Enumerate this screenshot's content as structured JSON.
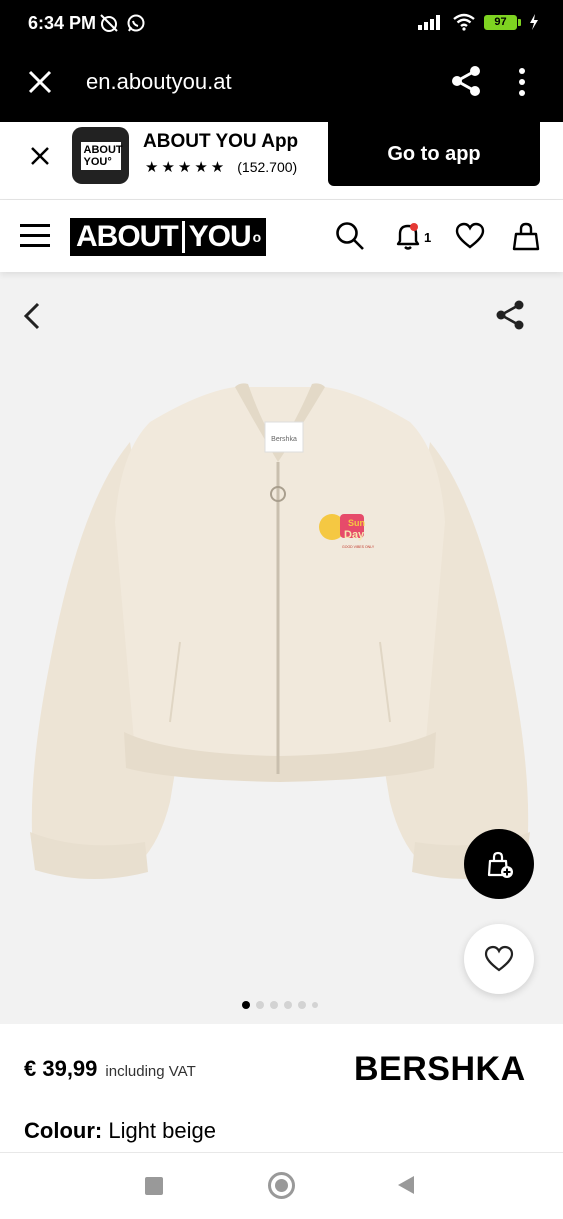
{
  "status_bar": {
    "time": "6:34 PM",
    "battery": "97",
    "icons": [
      "alarm-off-icon",
      "whatsapp-icon",
      "signal-icon",
      "wifi-icon",
      "battery-icon",
      "charging-icon"
    ]
  },
  "browser": {
    "url": "en.aboutyou.at",
    "icons": [
      "close-icon",
      "share-icon",
      "more-vertical-icon"
    ]
  },
  "app_banner": {
    "icon_text_line1": "ABOUT",
    "icon_text_line2": "YOU°",
    "app_name": "ABOUT YOU App",
    "stars": "★★★★★",
    "rating_count": "(152.700)",
    "cta_label": "Go to app"
  },
  "header": {
    "logo_left": "ABOUT",
    "logo_right": "YOU",
    "logo_mark": "o",
    "notification_count": "1",
    "icons": [
      "menu-icon",
      "search-icon",
      "bell-icon",
      "heart-icon",
      "bag-icon"
    ]
  },
  "product": {
    "garment_label": "Bershka",
    "patch_line1": "Sun",
    "patch_line2": "Day",
    "patch_tagline": "GOOD VIBES ONLY",
    "image_count": 6,
    "active_image": 0,
    "colors": {
      "garment": "#f1e9dc",
      "garment_shadow": "#e4dac9",
      "background": "#f2f2f2"
    }
  },
  "details": {
    "price": "€ 39,99",
    "vat_note": "including VAT",
    "brand": "BERSHKA",
    "colour_label": "Colour:",
    "colour_value": "Light beige"
  }
}
